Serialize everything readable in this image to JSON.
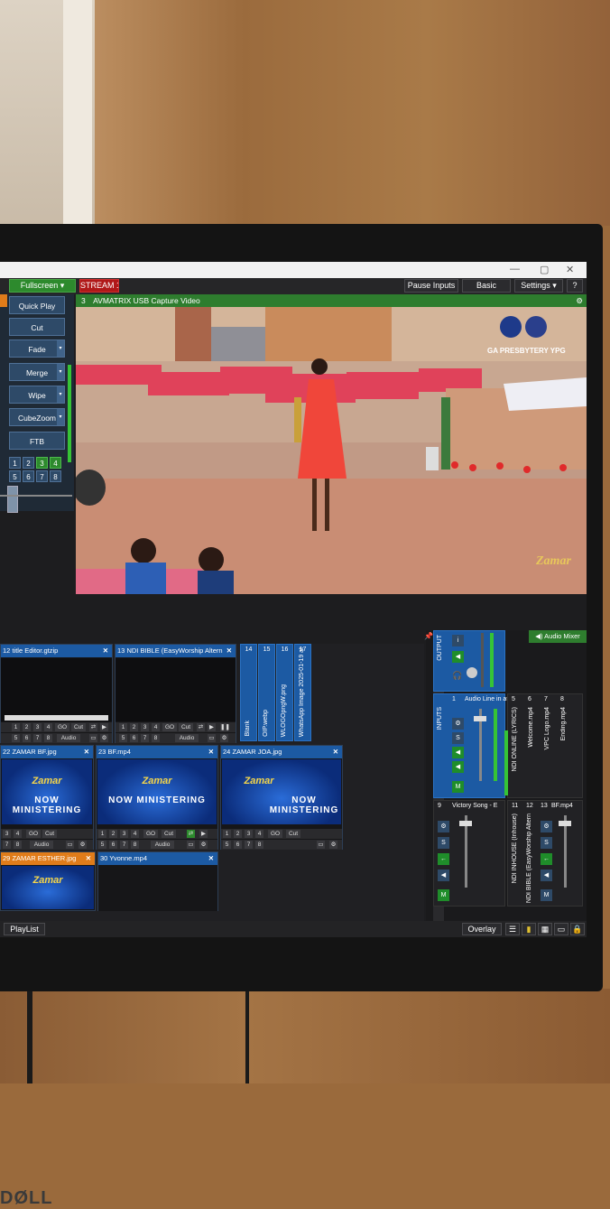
{
  "window": {
    "close": "✕",
    "max": "▢",
    "min": "—"
  },
  "topbar": {
    "fullscreen": "Fullscreen",
    "stream": "STREAM 1",
    "pause_inputs": "Pause Inputs",
    "basic": "Basic",
    "settings": "Settings",
    "help": "?"
  },
  "transitions": {
    "buttons": [
      "Quick Play",
      "Cut",
      "Fade",
      "Merge",
      "Wipe",
      "CubeZoom",
      "FTB"
    ],
    "numbers_row1": [
      "1",
      "2",
      "3",
      "4"
    ],
    "numbers_row2": [
      "5",
      "6",
      "7",
      "8"
    ]
  },
  "output": {
    "number": "3",
    "title": "AVMATRIX USB Capture Video",
    "logo_text": "GA PRESBYTERY YPG"
  },
  "audio_mixer": {
    "title": "Audio Mixer",
    "output_label": "OUTPUT",
    "inputs_label": "INPUTS",
    "channels": [
      {
        "num": "1",
        "name": "Audio Line in at"
      },
      {
        "num": "5",
        "name": "NDI ONLINE (LYRICS)"
      },
      {
        "num": "6",
        "name": "Welcome.mp4"
      },
      {
        "num": "7",
        "name": "VPC Logo.mp4"
      },
      {
        "num": "8",
        "name": "Ending.mp4"
      },
      {
        "num": "9",
        "name": "Victory Song - E"
      },
      {
        "num": "11",
        "name": "NDI INHOUSE (Inhouse)"
      },
      {
        "num": "12",
        "name": "NDI BIBLE (EasyWorship Altern"
      },
      {
        "num": "13",
        "name": "BF.mp4"
      }
    ],
    "buttons": {
      "s": "S",
      "m": "M",
      "i": "i"
    }
  },
  "inputs": {
    "cards": [
      {
        "num": "12",
        "title": "title Editor.gtzip"
      },
      {
        "num": "13",
        "title": "NDI BIBLE (EasyWorship Altern"
      },
      {
        "num": "22",
        "title": "ZAMAR BF.jpg"
      },
      {
        "num": "23",
        "title": "BF.mp4"
      },
      {
        "num": "24",
        "title": "ZAMAR JOA.jpg"
      },
      {
        "num": "29",
        "title": "ZAMAR ESTHER.jpg"
      },
      {
        "num": "30",
        "title": "Yvonne.mp4"
      }
    ],
    "vertical_tabs": [
      {
        "num": "14",
        "label": "Blank"
      },
      {
        "num": "15",
        "label": "OIP.webp"
      },
      {
        "num": "16",
        "label": "WLOGOpngW.png"
      },
      {
        "num": "17",
        "label": "WhatsApp Image 2025-01-19 at"
      }
    ],
    "controls": {
      "numbers": [
        "1",
        "2",
        "3",
        "4",
        "5",
        "6",
        "7",
        "8"
      ],
      "go": "GO",
      "cut": "Cut",
      "audio": "Audio"
    },
    "thumb_title": "Zamar",
    "thumb_subtitle": "NOW MINISTERING"
  },
  "bottom": {
    "playlist": "PlayList",
    "overlay": "Overlay"
  },
  "monitor": {
    "brand": "DØLL"
  }
}
